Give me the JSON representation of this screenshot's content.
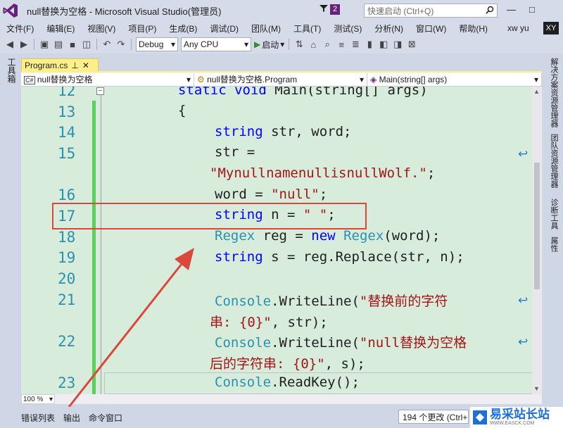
{
  "window": {
    "title": "null替换为空格 - Microsoft Visual Studio(管理员)",
    "notification_count": "2",
    "quick_launch_placeholder": "快速启动 (Ctrl+Q)",
    "minimize": "—",
    "maximize": "□"
  },
  "menu": {
    "items": [
      "文件(F)",
      "编辑(E)",
      "视图(V)",
      "项目(P)",
      "生成(B)",
      "调试(D)",
      "团队(M)",
      "工具(T)",
      "测试(S)",
      "分析(N)",
      "窗口(W)",
      "帮助(H)"
    ],
    "user_name": "xw yu",
    "user_initials": "XY"
  },
  "toolbar": {
    "config": "Debug",
    "platform": "Any CPU",
    "start_label": "启动"
  },
  "left_strip": {
    "toolbox": "工具箱"
  },
  "right_strip": {
    "tabs": [
      "解决方案资源管理器",
      "团队资源管理器",
      "诊断工具",
      "属性"
    ]
  },
  "document": {
    "tab_label": "Program.cs",
    "pin": "⊥",
    "close": "✕"
  },
  "navbar": {
    "project": "null替换为空格",
    "class": "null替换为空格.Program",
    "member": "Main(string[] args)"
  },
  "code": {
    "line_numbers": [
      "12",
      "13",
      "14",
      "15",
      "16",
      "17",
      "18",
      "19",
      "20",
      "21",
      "22",
      "23"
    ],
    "l12_a": "static void",
    "l12_b": "Main(string[] args)",
    "l13": "{",
    "l14_kw": "string",
    "l14_rest": "str, word;",
    "l15_a": "str =",
    "l15_b": "\"MynullnamenullisnullWolf.\"",
    "l15_c": ";",
    "l16_a": "word = ",
    "l16_b": "\"null\"",
    "l16_c": ";",
    "l17_kw": "string",
    "l17_a": "n = ",
    "l17_b": "\" \"",
    "l17_c": ";",
    "l18_ty": "Regex",
    "l18_a": "reg = ",
    "l18_kw": "new",
    "l18_ty2": "Regex",
    "l18_b": "(word);",
    "l19_kw": "string",
    "l19_a": "s = reg.Replace(str, n);",
    "l21_ty": "Console",
    "l21_a": ".WriteLine(",
    "l21_b": "\"替换前的字符",
    "l21_c": "串: {0}\"",
    "l21_d": ", str);",
    "l22_ty": "Console",
    "l22_a": ".WriteLine(",
    "l22_b": "\"null替换为空格",
    "l22_c": "后的字符串: {0}\"",
    "l22_d": ", s);",
    "l23_ty": "Console",
    "l23_a": ".ReadKey();"
  },
  "status": {
    "zoom": "100 %",
    "bottom_tabs": [
      "错误列表",
      "输出",
      "命令窗口"
    ],
    "changes": "194 个更改 (Ctrl+"
  },
  "watermark": {
    "title": "易采站长站",
    "url": "WWW.EASCK.COM"
  },
  "colors": {
    "editor_bg": "#d8ecdc",
    "keyword": "#0000ff",
    "type": "#2b91af",
    "string": "#a31515",
    "annotation": "#d9483b",
    "tab_active": "#fdf08a"
  }
}
